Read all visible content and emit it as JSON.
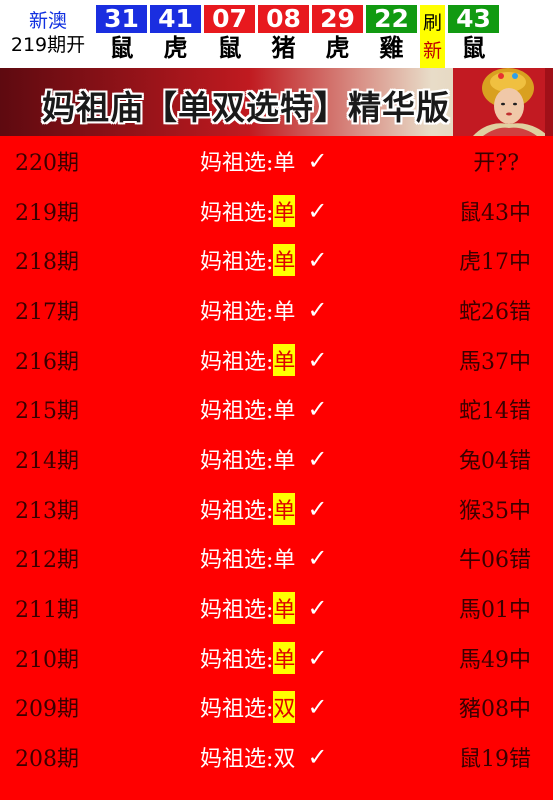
{
  "header": {
    "lottery_name": "新澳",
    "issue_label": "219期开",
    "balls": [
      {
        "number": "31",
        "zodiac": "鼠",
        "color": "#1a2ee0"
      },
      {
        "number": "41",
        "zodiac": "虎",
        "color": "#1a2ee0"
      },
      {
        "number": "07",
        "zodiac": "鼠",
        "color": "#e8191e"
      },
      {
        "number": "08",
        "zodiac": "猪",
        "color": "#e8191e"
      },
      {
        "number": "29",
        "zodiac": "虎",
        "color": "#e8191e"
      },
      {
        "number": "22",
        "zodiac": "雞",
        "color": "#119a11"
      }
    ],
    "refresh": {
      "line1": "刷",
      "line2": "新"
    },
    "special_ball": {
      "number": "43",
      "zodiac": "鼠",
      "color": "#119a11"
    }
  },
  "banner": {
    "title": "妈祖庙【单双选特】精华版"
  },
  "rows": [
    {
      "period": "220期",
      "label": "妈祖选:",
      "pick": "单",
      "highlight": false,
      "check": "✓",
      "result": "开??"
    },
    {
      "period": "219期",
      "label": "妈祖选:",
      "pick": "单",
      "highlight": true,
      "check": "✓",
      "result": "鼠43中"
    },
    {
      "period": "218期",
      "label": "妈祖选:",
      "pick": "单",
      "highlight": true,
      "check": "✓",
      "result": "虎17中"
    },
    {
      "period": "217期",
      "label": "妈祖选:",
      "pick": "单",
      "highlight": false,
      "check": "✓",
      "result": "蛇26错"
    },
    {
      "period": "216期",
      "label": "妈祖选:",
      "pick": "单",
      "highlight": true,
      "check": "✓",
      "result": "馬37中"
    },
    {
      "period": "215期",
      "label": "妈祖选:",
      "pick": "单",
      "highlight": false,
      "check": "✓",
      "result": "蛇14错"
    },
    {
      "period": "214期",
      "label": "妈祖选:",
      "pick": "单",
      "highlight": false,
      "check": "✓",
      "result": "兔04错"
    },
    {
      "period": "213期",
      "label": "妈祖选:",
      "pick": "单",
      "highlight": true,
      "check": "✓",
      "result": "猴35中"
    },
    {
      "period": "212期",
      "label": "妈祖选:",
      "pick": "单",
      "highlight": false,
      "check": "✓",
      "result": "牛06错"
    },
    {
      "period": "211期",
      "label": "妈祖选:",
      "pick": "单",
      "highlight": true,
      "check": "✓",
      "result": "馬01中"
    },
    {
      "period": "210期",
      "label": "妈祖选:",
      "pick": "单",
      "highlight": true,
      "check": "✓",
      "result": "馬49中"
    },
    {
      "period": "209期",
      "label": "妈祖选:",
      "pick": "双",
      "highlight": true,
      "check": "✓",
      "result": "豬08中"
    },
    {
      "period": "208期",
      "label": "妈祖选:",
      "pick": "双",
      "highlight": false,
      "check": "✓",
      "result": "鼠19错"
    }
  ]
}
